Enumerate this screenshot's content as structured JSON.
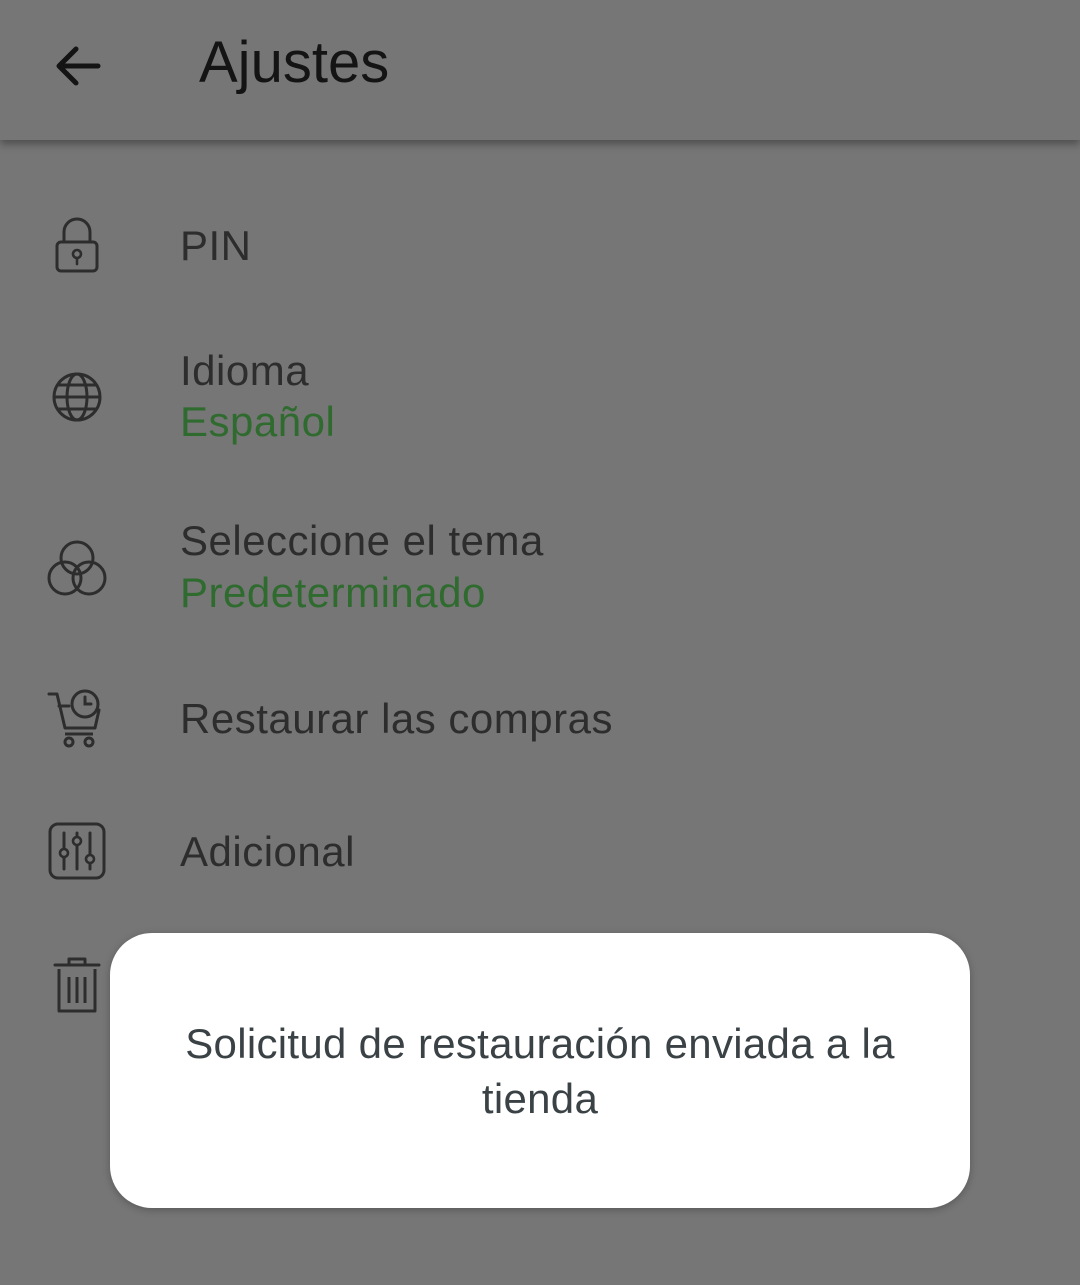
{
  "header": {
    "title": "Ajustes",
    "back_icon": "arrow-left-icon"
  },
  "settings": {
    "items": [
      {
        "label": "PIN",
        "icon": "lock-icon"
      },
      {
        "label": "Idioma",
        "value": "Español",
        "icon": "globe-icon"
      },
      {
        "label": "Seleccione el tema",
        "value": "Predeterminado",
        "icon": "theme-circles-icon"
      },
      {
        "label": "Restaurar las compras",
        "icon": "cart-clock-icon"
      },
      {
        "label": "Adicional",
        "icon": "sliders-icon"
      },
      {
        "label": "",
        "icon": "trash-icon"
      }
    ]
  },
  "toast": {
    "message": "Solicitud de restauración enviada a la tienda"
  },
  "colors": {
    "background": "#767676",
    "accent_value": "#2f6b2f",
    "toast_bg": "#ffffff",
    "text": "#2d2d2d"
  }
}
